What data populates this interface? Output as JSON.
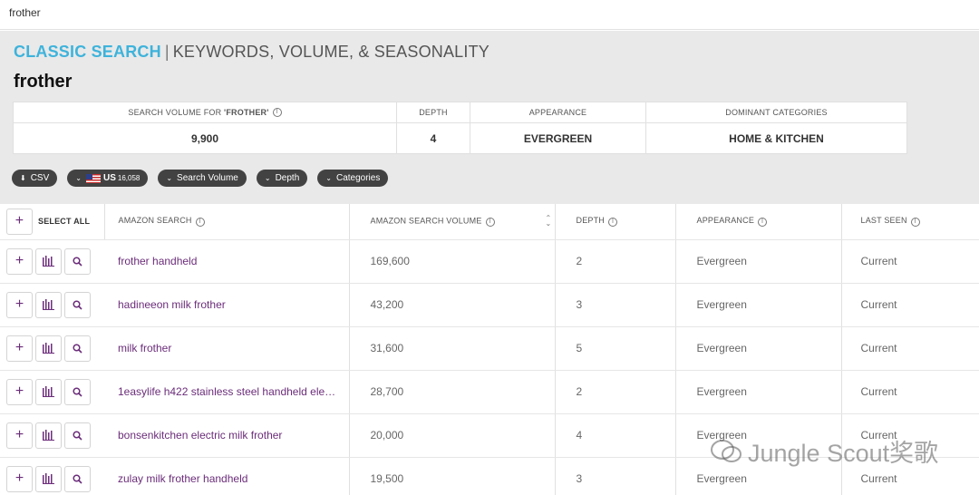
{
  "search": {
    "value": "frother"
  },
  "header": {
    "title_accent": "CLASSIC SEARCH",
    "title_sep": "|",
    "title_rest": "KEYWORDS, VOLUME, & SEASONALITY",
    "keyword": "frother"
  },
  "stats": [
    {
      "label_pre": "SEARCH VOLUME FOR ",
      "label_quote": "'FROTHER'",
      "value": "9,900",
      "has_info": true
    },
    {
      "label_pre": "DEPTH",
      "label_quote": "",
      "value": "4",
      "has_info": false
    },
    {
      "label_pre": "APPEARANCE",
      "label_quote": "",
      "value": "EVERGREEN",
      "has_info": false
    },
    {
      "label_pre": "DOMINANT CATEGORIES",
      "label_quote": "",
      "value": "HOME & KITCHEN",
      "has_info": false
    }
  ],
  "filters": {
    "csv": "CSV",
    "market": "US",
    "market_count": "16,058",
    "search_volume": "Search Volume",
    "depth": "Depth",
    "categories": "Categories"
  },
  "table": {
    "select_all": "SELECT ALL",
    "columns": [
      "AMAZON SEARCH",
      "AMAZON SEARCH VOLUME",
      "DEPTH",
      "APPEARANCE",
      "LAST SEEN"
    ],
    "rows": [
      {
        "keyword": "frother handheld",
        "volume": "169,600",
        "depth": "2",
        "appearance": "Evergreen",
        "last_seen": "Current"
      },
      {
        "keyword": "hadineeon milk frother",
        "volume": "43,200",
        "depth": "3",
        "appearance": "Evergreen",
        "last_seen": "Current"
      },
      {
        "keyword": "milk frother",
        "volume": "31,600",
        "depth": "5",
        "appearance": "Evergreen",
        "last_seen": "Current"
      },
      {
        "keyword": "1easylife h422 stainless steel handheld elect...",
        "volume": "28,700",
        "depth": "2",
        "appearance": "Evergreen",
        "last_seen": "Current"
      },
      {
        "keyword": "bonsenkitchen electric milk frother",
        "volume": "20,000",
        "depth": "4",
        "appearance": "Evergreen",
        "last_seen": "Current"
      },
      {
        "keyword": "zulay milk frother handheld",
        "volume": "19,500",
        "depth": "3",
        "appearance": "Evergreen",
        "last_seen": "Current"
      }
    ]
  },
  "watermark": {
    "text": "Jungle Scout奖歌"
  },
  "colors": {
    "accent": "#3eb3db",
    "keyword_purple": "#6b2d7a",
    "pill_bg": "#424242",
    "header_bg": "#e9e9e9"
  }
}
